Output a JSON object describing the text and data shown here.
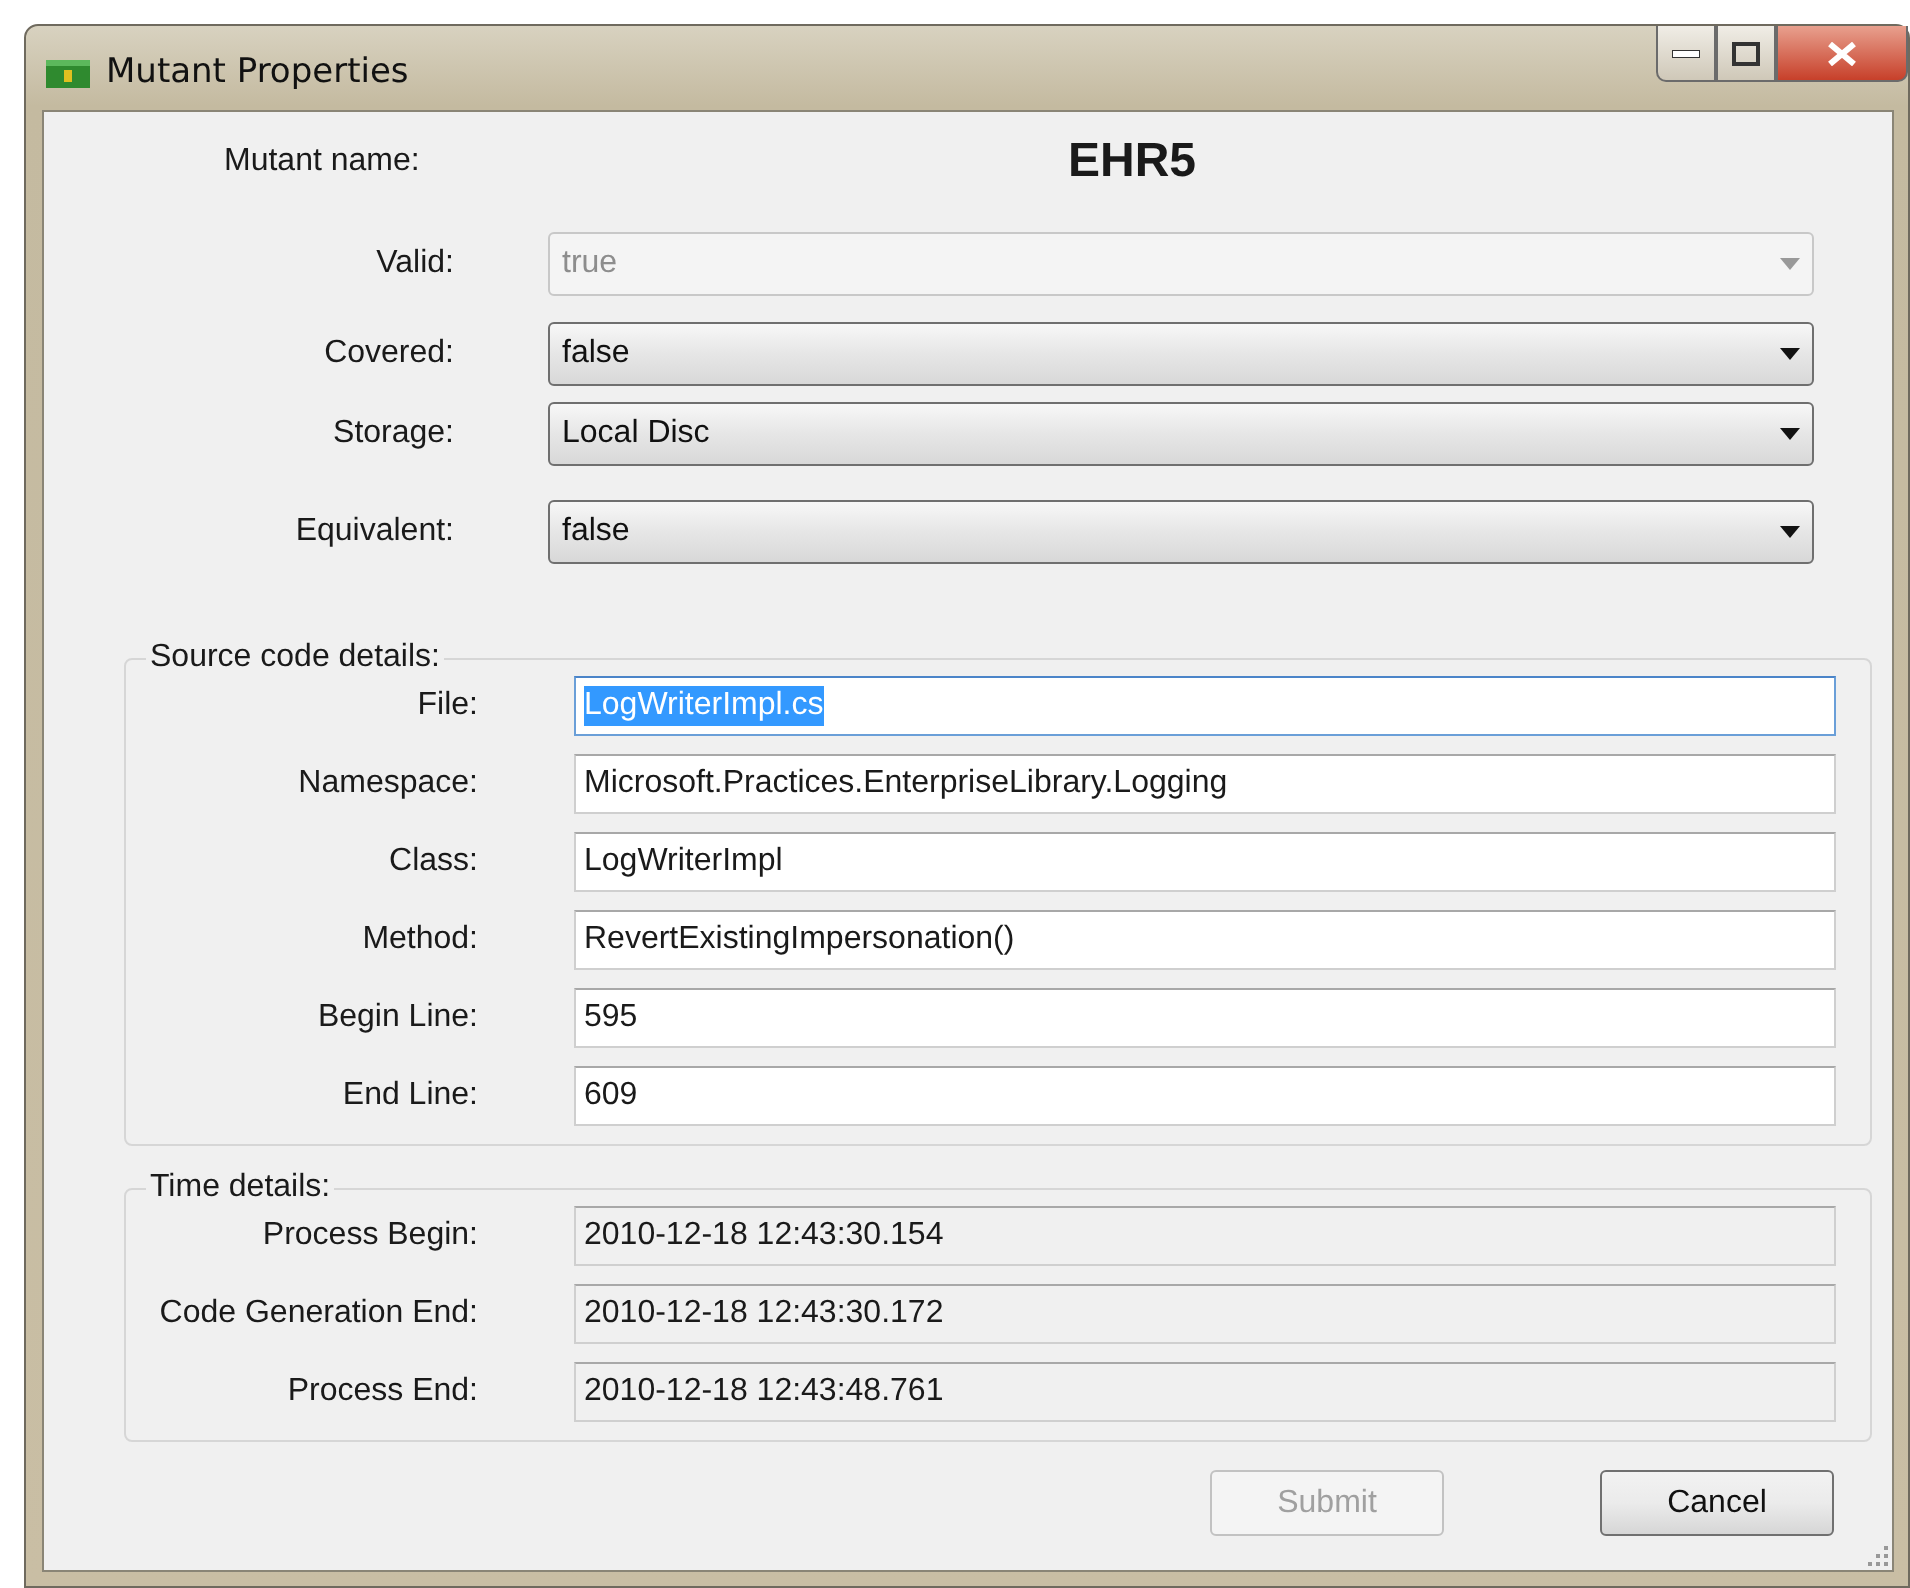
{
  "window": {
    "title": "Mutant Properties"
  },
  "mutant_name": {
    "label": "Mutant name:",
    "value": "EHR5"
  },
  "dropdowns": [
    {
      "label": "Valid:",
      "value": "true",
      "disabled": true
    },
    {
      "label": "Covered:",
      "value": "false",
      "disabled": false
    },
    {
      "label": "Storage:",
      "value": "Local Disc",
      "disabled": false
    },
    {
      "label": "Equivalent:",
      "value": "false",
      "disabled": false
    }
  ],
  "source_code_details": {
    "title": "Source code details:",
    "fields": [
      {
        "label": "File:",
        "value": "LogWriterImpl.cs",
        "highlighted": true
      },
      {
        "label": "Namespace:",
        "value": "Microsoft.Practices.EnterpriseLibrary.Logging",
        "highlighted": false
      },
      {
        "label": "Class:",
        "value": "LogWriterImpl",
        "highlighted": false
      },
      {
        "label": "Method:",
        "value": "RevertExistingImpersonation()",
        "highlighted": false
      },
      {
        "label": "Begin Line:",
        "value": "595",
        "highlighted": false
      },
      {
        "label": "End Line:",
        "value": "609",
        "highlighted": false
      }
    ]
  },
  "time_details": {
    "title": "Time details:",
    "fields": [
      {
        "label": "Process Begin:",
        "value": "2010-12-18 12:43:30.154"
      },
      {
        "label": "Code Generation End:",
        "value": "2010-12-18 12:43:30.172"
      },
      {
        "label": "Process End:",
        "value": "2010-12-18 12:43:48.761"
      }
    ]
  },
  "buttons": [
    {
      "label": "Submit",
      "disabled": true
    },
    {
      "label": "Cancel",
      "disabled": false
    }
  ]
}
